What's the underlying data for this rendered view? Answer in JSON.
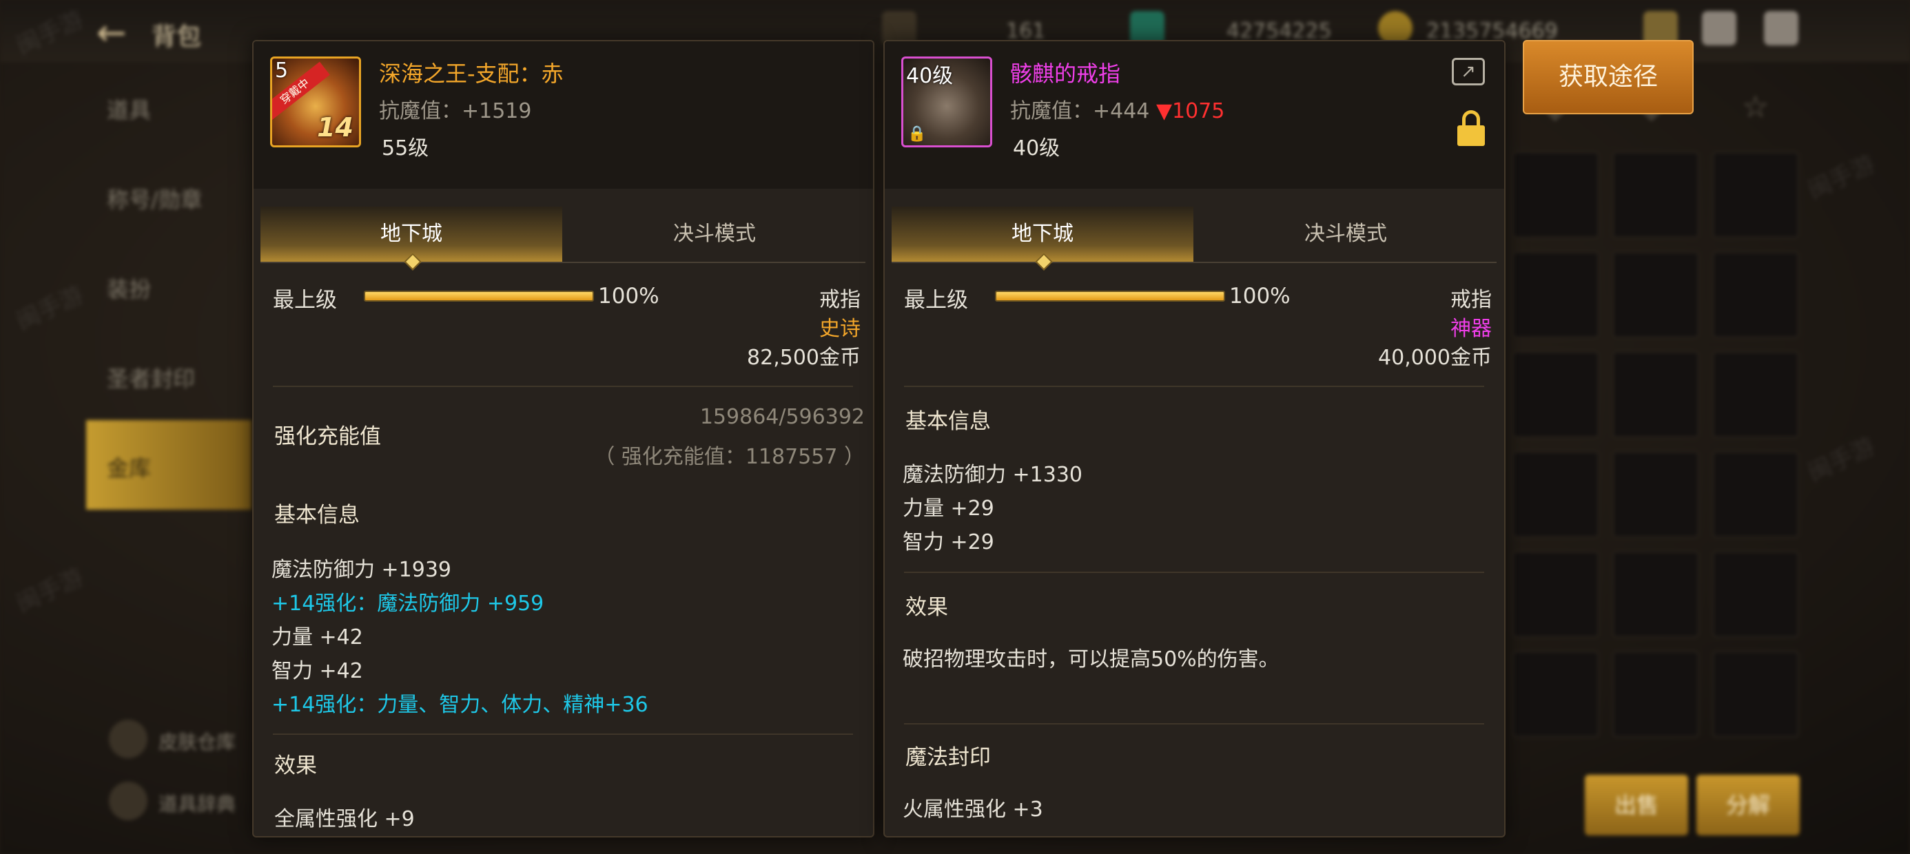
{
  "background": {
    "bag_title": "背包",
    "top_stats": [
      "161",
      "42754225",
      "2135754669"
    ],
    "sidebar": [
      "道具",
      "称号/勋章",
      "装扮",
      "圣者封印",
      "金库"
    ],
    "sidebar_footer": [
      "皮肤仓库",
      "道具辞典"
    ],
    "bottom_buttons": [
      "出售",
      "分解"
    ],
    "watermark": "闽手游"
  },
  "acquire_button": "获取途径",
  "left": {
    "icon_level": "5",
    "icon_ribbon": "穿戴中",
    "icon_plus": "14",
    "name": "深海之王-支配：赤",
    "resist_label": "抗魔值：+1519",
    "level": "55级",
    "tabs": [
      "地下城",
      "决斗模式"
    ],
    "level_label": "最上级",
    "level_pct": "100%",
    "level_fill": 1.0,
    "slot": "戒指",
    "rarity": "史诗",
    "price": "82,500金币",
    "charge_title": "强化充能值",
    "charge_nums": "159864/596392",
    "charge_sub": "（ 强化充能值：1187557 ）",
    "basic_title": "基本信息",
    "stats": [
      {
        "text": "魔法防御力 +1939",
        "color": "white"
      },
      {
        "text": "+14强化：魔法防御力 +959",
        "color": "cyan"
      },
      {
        "text": "力量 +42",
        "color": "white"
      },
      {
        "text": "智力 +42",
        "color": "white"
      },
      {
        "text": "+14强化：力量、智力、体力、精神+36",
        "color": "cyan"
      }
    ],
    "effect_title": "效果",
    "effect_text": "全属性强化 +9"
  },
  "right": {
    "icon_level": "40级",
    "name": "骸麒的戒指",
    "resist_label": "抗魔值：+444",
    "resist_down": "▼1075",
    "level": "40级",
    "tabs": [
      "地下城",
      "决斗模式"
    ],
    "level_label": "最上级",
    "level_pct": "100%",
    "level_fill": 1.0,
    "slot": "戒指",
    "rarity": "神器",
    "price": "40,000金币",
    "basic_title": "基本信息",
    "stats": [
      "魔法防御力 +1330",
      "力量 +29",
      "智力 +29"
    ],
    "effect_title": "效果",
    "effect_text": "破招物理攻击时，可以提高50%的伤害。",
    "seal_title": "魔法封印",
    "seal_text": "火属性强化 +3"
  },
  "colors": {
    "epic": "#f4a72a",
    "artifact": "#ef3fe9",
    "enhance": "#1ec8e8",
    "decrease": "#ff3030",
    "button": "#c9781c"
  }
}
